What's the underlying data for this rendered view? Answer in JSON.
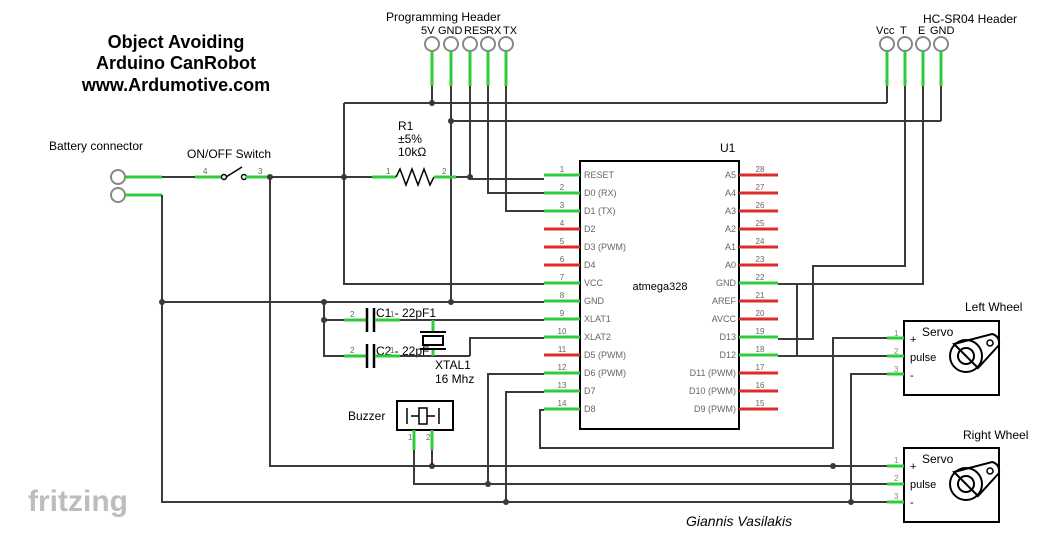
{
  "title": {
    "line1": "Object Avoiding",
    "line2": "Arduino CanRobot",
    "line3": "www.Ardumotive.com"
  },
  "author": "Giannis Vasilakis",
  "logo": "fritzing",
  "programming_header": {
    "title": "Programming Header",
    "pins": [
      "5V",
      "GND",
      "RES",
      "RX",
      "TX"
    ]
  },
  "hcsr04_header": {
    "title": "HC-SR04 Header",
    "pins": [
      "Vcc",
      "T",
      "E",
      "GND"
    ]
  },
  "battery": {
    "label": "Battery connector"
  },
  "switch": {
    "label": "ON/OFF Switch",
    "pin_a": "4",
    "pin_b": "3"
  },
  "resistor": {
    "ref": "R1",
    "tol": "±5%",
    "value": "10kΩ",
    "pin1": "1",
    "pin2": "2"
  },
  "caps": [
    {
      "label": "C1 - 22pF1",
      "p1": "2",
      "p2": "1"
    },
    {
      "label": "C2 - 22pF",
      "p1": "2",
      "p2": "1"
    }
  ],
  "crystal": {
    "ref": "XTAL1",
    "value": "16 Mhz"
  },
  "buzzer": {
    "label": "Buzzer",
    "p1": "1",
    "p2": "2"
  },
  "mcu": {
    "ref": "U1",
    "name": "atmega328",
    "left_pins": [
      {
        "n": "1",
        "name": "RESET"
      },
      {
        "n": "2",
        "name": "D0 (RX)"
      },
      {
        "n": "3",
        "name": "D1 (TX)"
      },
      {
        "n": "4",
        "name": "D2"
      },
      {
        "n": "5",
        "name": "D3 (PWM)"
      },
      {
        "n": "6",
        "name": "D4"
      },
      {
        "n": "7",
        "name": "VCC"
      },
      {
        "n": "8",
        "name": "GND"
      },
      {
        "n": "9",
        "name": "XLAT1"
      },
      {
        "n": "10",
        "name": "XLAT2"
      },
      {
        "n": "11",
        "name": "D5 (PWM)"
      },
      {
        "n": "12",
        "name": "D6 (PWM)"
      },
      {
        "n": "13",
        "name": "D7"
      },
      {
        "n": "14",
        "name": "D8"
      }
    ],
    "right_pins": [
      {
        "n": "28",
        "name": "A5"
      },
      {
        "n": "27",
        "name": "A4"
      },
      {
        "n": "26",
        "name": "A3"
      },
      {
        "n": "25",
        "name": "A2"
      },
      {
        "n": "24",
        "name": "A1"
      },
      {
        "n": "23",
        "name": "A0"
      },
      {
        "n": "22",
        "name": "GND"
      },
      {
        "n": "21",
        "name": "AREF"
      },
      {
        "n": "20",
        "name": "AVCC"
      },
      {
        "n": "19",
        "name": "D13"
      },
      {
        "n": "18",
        "name": "D12"
      },
      {
        "n": "17",
        "name": "D11 (PWM)"
      },
      {
        "n": "16",
        "name": "D10 (PWM)"
      },
      {
        "n": "15",
        "name": "D9 (PWM)"
      }
    ]
  },
  "servos": [
    {
      "heading": "Left Wheel",
      "label": "Servo",
      "pins": [
        {
          "n": "1",
          "name": "+"
        },
        {
          "n": "2",
          "name": "pulse"
        },
        {
          "n": "3",
          "name": "-"
        }
      ]
    },
    {
      "heading": "Right Wheel",
      "label": "Servo",
      "pins": [
        {
          "n": "1",
          "name": "+"
        },
        {
          "n": "2",
          "name": "pulse"
        },
        {
          "n": "3",
          "name": "-"
        }
      ]
    }
  ]
}
